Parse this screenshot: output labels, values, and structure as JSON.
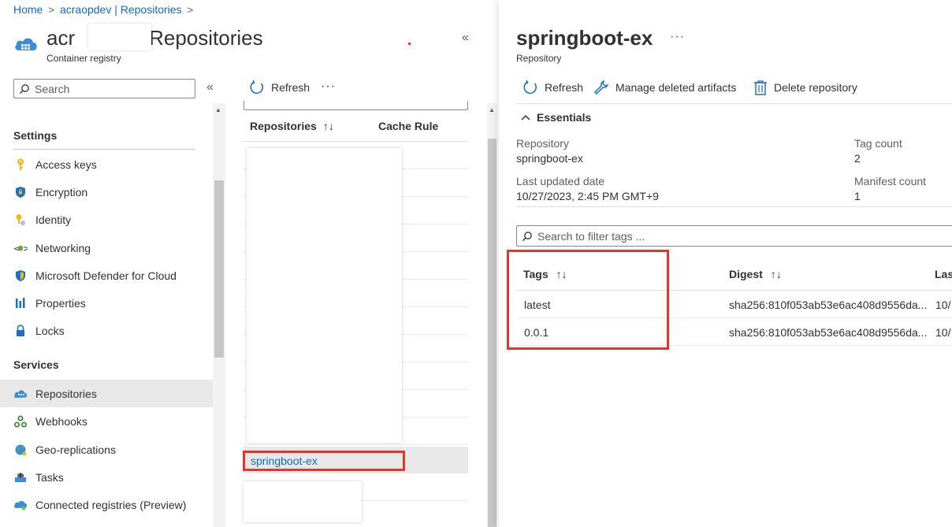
{
  "breadcrumb": {
    "items": [
      "Home",
      "acraopdev | Repositories"
    ],
    "separator": ">"
  },
  "registry": {
    "title_prefix": "acr",
    "title_suffix": "| Repositories",
    "subtitle": "Container registry"
  },
  "left_panel": {
    "collapse_icon": "double-chevron-left-icon",
    "search_placeholder": "Search",
    "sections": [
      {
        "heading": "Settings",
        "items": [
          {
            "label": "Access keys",
            "icon": "key-icon"
          },
          {
            "label": "Encryption",
            "icon": "shield-lock-icon"
          },
          {
            "label": "Identity",
            "icon": "identity-key-icon"
          },
          {
            "label": "Networking",
            "icon": "networking-icon"
          },
          {
            "label": "Microsoft Defender for Cloud",
            "icon": "defender-shield-icon"
          },
          {
            "label": "Properties",
            "icon": "properties-bars-icon"
          },
          {
            "label": "Locks",
            "icon": "lock-icon"
          }
        ]
      },
      {
        "heading": "Services",
        "items": [
          {
            "label": "Repositories",
            "icon": "repositories-cloud-icon",
            "selected": true
          },
          {
            "label": "Webhooks",
            "icon": "webhooks-icon"
          },
          {
            "label": "Geo-replications",
            "icon": "globe-icon"
          },
          {
            "label": "Tasks",
            "icon": "tasks-icon"
          },
          {
            "label": "Connected registries (Preview)",
            "icon": "connected-registries-icon"
          }
        ]
      }
    ]
  },
  "middle_panel": {
    "toolbar": {
      "refresh_label": "Refresh",
      "more_label": "···"
    },
    "columns": [
      "Repositories",
      "Cache Rule"
    ],
    "selected_repository": "springboot-ex"
  },
  "blade": {
    "title": "springboot-ex",
    "more_label": "···",
    "subtitle": "Repository",
    "toolbar": {
      "refresh_label": "Refresh",
      "manage_label": "Manage deleted artifacts",
      "delete_label": "Delete repository"
    },
    "essentials": {
      "toggle_label": "Essentials",
      "repository_label": "Repository",
      "repository_value": "springboot-ex",
      "tag_count_label": "Tag count",
      "tag_count_value": "2",
      "updated_label": "Last updated date",
      "updated_value": "10/27/2023, 2:45 PM GMT+9",
      "manifest_count_label": "Manifest count",
      "manifest_count_value": "1"
    },
    "tag_filter_placeholder": "Search to filter tags ...",
    "tags_table": {
      "columns": [
        "Tags",
        "Digest",
        "Las"
      ],
      "rows": [
        {
          "tag": "latest",
          "digest": "sha256:810f053ab53e6ac408d9556da...",
          "last": "10/"
        },
        {
          "tag": "0.0.1",
          "digest": "sha256:810f053ab53e6ac408d9556da...",
          "last": "10/"
        }
      ]
    }
  },
  "colors": {
    "link": "#0f6cbd",
    "highlight": "#e5362d",
    "selected_row": "#e8e8e8"
  }
}
